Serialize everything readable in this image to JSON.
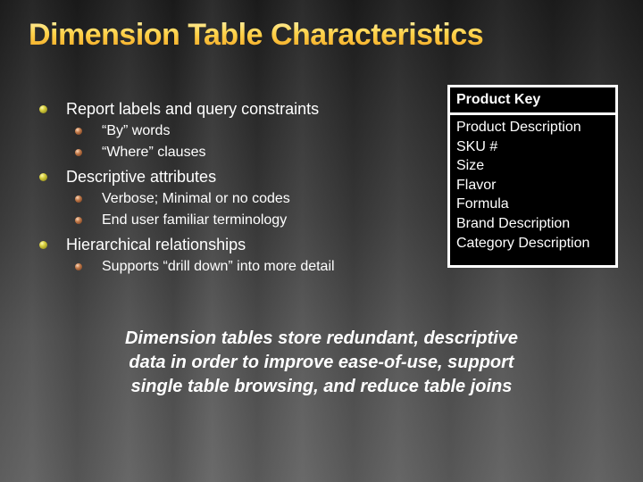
{
  "slide": {
    "title": "Dimension Table Characteristics",
    "title_colors": {
      "top": "#fff3b0",
      "bottom": "#f0a020"
    },
    "bullets": [
      {
        "text": "Report labels and query constraints",
        "icon": "olive-sphere-bullet-icon",
        "children": [
          {
            "text": "“By” words",
            "icon": "copper-sphere-bullet-icon"
          },
          {
            "text": "“Where” clauses",
            "icon": "copper-sphere-bullet-icon"
          }
        ]
      },
      {
        "text": "Descriptive attributes",
        "icon": "olive-sphere-bullet-icon",
        "children": [
          {
            "text": "Verbose; Minimal or no codes",
            "icon": "copper-sphere-bullet-icon"
          },
          {
            "text": "End user familiar terminology",
            "icon": "copper-sphere-bullet-icon"
          }
        ]
      },
      {
        "text": "Hierarchical relationships",
        "icon": "olive-sphere-bullet-icon",
        "children": [
          {
            "text": "Supports “drill down” into more detail",
            "icon": "copper-sphere-bullet-icon"
          }
        ]
      }
    ],
    "product_table": {
      "key": "Product Key",
      "attributes": [
        "Product Description",
        "SKU #",
        "Size",
        "Flavor",
        "Formula",
        "Brand Description",
        "Category Description"
      ]
    },
    "summary_lines": [
      "Dimension tables store redundant, descriptive",
      "data in order to improve ease-of-use, support",
      "single table browsing, and reduce table joins"
    ]
  }
}
